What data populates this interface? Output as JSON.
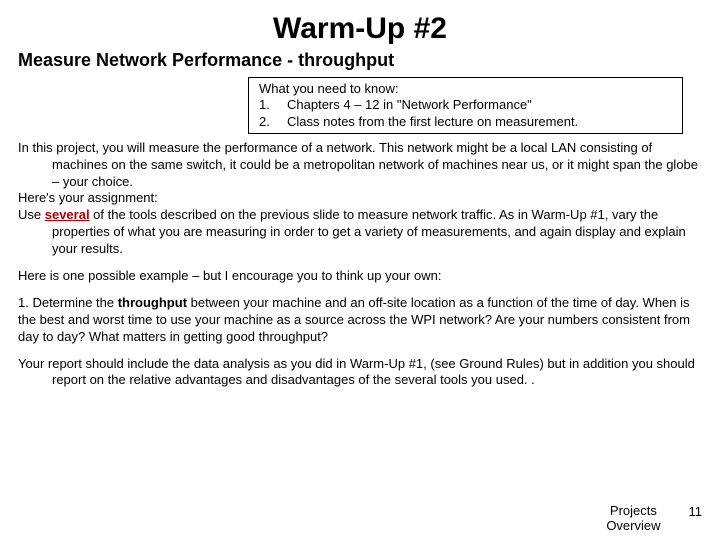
{
  "title": "Warm-Up #2",
  "subtitle": "Measure Network Performance - throughput",
  "need": {
    "header": "What you need to know:",
    "items": [
      {
        "num": "1.",
        "text": "Chapters 4 – 12  in \"Network Performance\""
      },
      {
        "num": "2.",
        "text": "Class notes from the first lecture on measurement."
      }
    ]
  },
  "para1_a": "In this project, you will measure the performance of a network.  This network might be a local LAN consisting of machines on the same switch, it could be a metropolitan network of machines near us, or it might span the globe – your choice.",
  "para1_b": "Here's your assignment:",
  "para1_c_pre": "Use ",
  "para1_c_em": "several",
  "para1_c_post": " of the tools described on the previous slide to measure network traffic.  As in Warm-Up #1, vary the properties of what you are measuring in order to get a variety of measurements, and again display and explain your results.",
  "para2": "Here is one possible example – but I encourage you to think up your own:",
  "para3_pre": "1.  Determine the ",
  "para3_bold": "throughput",
  "para3_post": " between your machine and an off-site location as a function of the time of day. When is the best and worst time to use your machine as a source across the WPI network? Are your numbers consistent from day to day? What matters in getting good throughput?",
  "para4": "Your report should include the data analysis as you did in Warm-Up #1, (see Ground Rules) but in addition you should report on the relative advantages and disadvantages of the several tools you used. .",
  "footer": {
    "label": "Projects Overview",
    "page": "11"
  }
}
